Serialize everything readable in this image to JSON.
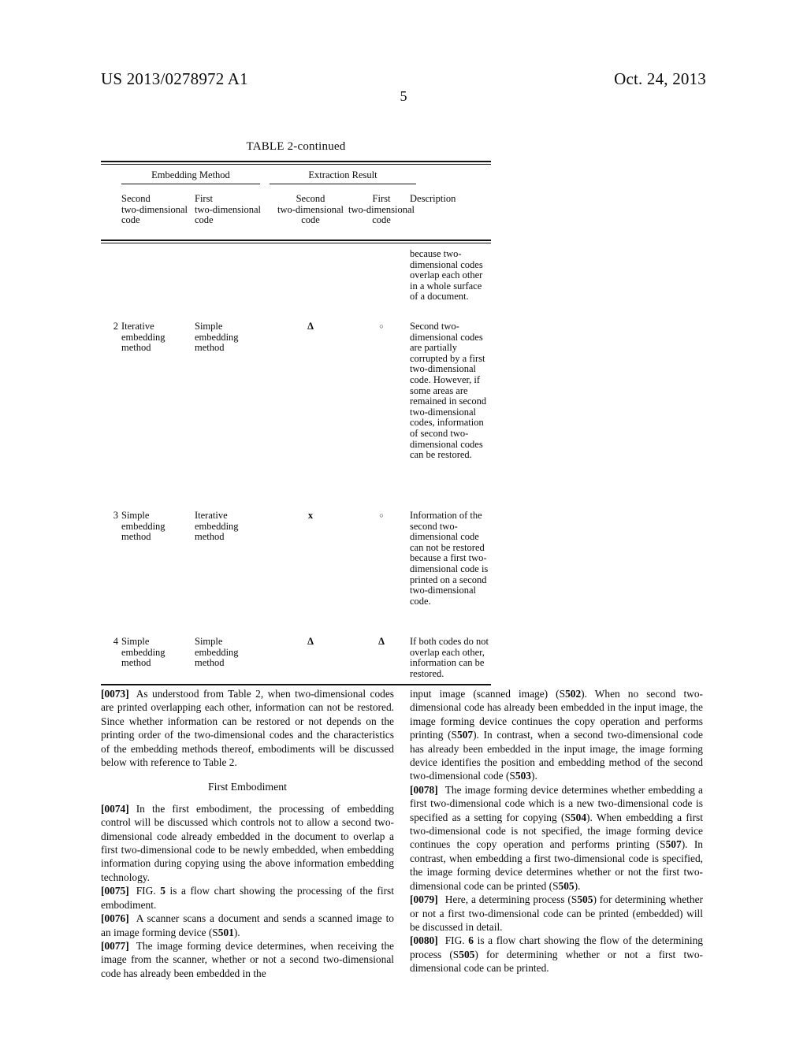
{
  "header": {
    "publication_number": "US 2013/0278972 A1",
    "publication_date": "Oct. 24, 2013",
    "page_number": "5"
  },
  "table": {
    "caption": "TABLE 2-continued",
    "group_headers": [
      {
        "label": "Embedding Method"
      },
      {
        "label": "Extraction Result"
      }
    ],
    "column_headers": [
      {
        "line1": "Second",
        "line2": "two-dimensional",
        "line3": "code"
      },
      {
        "line1": "First",
        "line2": "two-dimensional",
        "line3": "code"
      },
      {
        "line1": "Second",
        "line2": "two-dimensional",
        "line3": "code"
      },
      {
        "line1": "First",
        "line2": "two-dimensional",
        "line3": "code"
      },
      {
        "line1": "",
        "line2": "",
        "line3": "Description"
      }
    ],
    "continued_description": "because two-dimensional codes overlap each other in a whole surface of a document.",
    "rows": [
      {
        "num": "2",
        "embed_second": "Iterative embedding method",
        "embed_first": "Simple embedding method",
        "extract_second": "Δ",
        "extract_first": "○",
        "description": "Second two-dimensional codes are partially corrupted by a first two-dimensional code. However, if some areas are remained in second two-dimensional codes, information of second two-dimensional codes can be restored."
      },
      {
        "num": "3",
        "embed_second": "Simple embedding method",
        "embed_first": "Iterative embedding method",
        "extract_second": "x",
        "extract_first": "○",
        "description": "Information of the second two-dimensional code can not be restored because a first two-dimensional code is printed on a second two-dimensional code."
      },
      {
        "num": "4",
        "embed_second": "Simple embedding method",
        "embed_first": "Simple embedding method",
        "extract_second": "Δ",
        "extract_first": "Δ",
        "description": "If both codes do not overlap each other, information can be restored."
      }
    ]
  },
  "body": {
    "left_column": {
      "paragraphs": [
        {
          "id": "[0073]",
          "text": "As understood from Table 2, when two-dimensional codes are printed overlapping each other, information can not be restored. Since whether information can be restored or not depends on the printing order of the two-dimensional codes and the characteristics of the embedding methods thereof, embodiments will be discussed below with reference to Table 2."
        }
      ],
      "section_heading": "First Embodiment",
      "paragraphs_after_heading": [
        {
          "id": "[0074]",
          "text": "In the first embodiment, the processing of embedding control will be discussed which controls not to allow a second two-dimensional code already embedded in the document to overlap a first two-dimensional code to be newly embedded, when embedding information during copying using the above information embedding technology."
        },
        {
          "id": "[0075]",
          "text_part1": "FIG. ",
          "bold1": "5",
          "text_part2": " is a flow chart showing the processing of the first embodiment."
        },
        {
          "id": "[0076]",
          "text_part1": "A scanner scans a document and sends a scanned image to an image forming device (S",
          "bold1": "501",
          "text_part2": ")."
        },
        {
          "id": "[0077]",
          "text": "The image forming device determines, when receiving the image from the scanner, whether or not a second two-dimensional code has already been embedded in the"
        }
      ]
    },
    "right_column": {
      "continuation": {
        "text_part1": "input image (scanned image) (S",
        "bold1": "502",
        "text_part2": "). When no second two-dimensional code has already been embedded in the input image, the image forming device continues the copy operation and performs printing (S",
        "bold2": "507",
        "text_part3": "). In contrast, when a second two-dimensional code has already been embedded in the input image, the image forming device identifies the position and embedding method of the second two-dimensional code (S",
        "bold3": "503",
        "text_part4": ")."
      },
      "paragraphs": [
        {
          "id": "[0078]",
          "text_part1": "The image forming device determines whether embedding a first two-dimensional code which is a new two-dimensional code is specified as a setting for copying (S",
          "bold1": "504",
          "text_part2": "). When embedding a first two-dimensional code is not specified, the image forming device continues the copy operation and performs printing (S",
          "bold2": "507",
          "text_part3": "). In contrast, when embedding a first two-dimensional code is specified, the image forming device determines whether or not the first two-dimensional code can be printed (S",
          "bold3": "505",
          "text_part4": ")."
        },
        {
          "id": "[0079]",
          "text_part1": "Here, a determining process (S",
          "bold1": "505",
          "text_part2": ") for determining whether or not a first two-dimensional code can be printed (embedded) will be discussed in detail."
        },
        {
          "id": "[0080]",
          "text_part1": "FIG. ",
          "bold1": "6",
          "text_part2": " is a flow chart showing the flow of the determining process (S",
          "bold2": "505",
          "text_part3": ") for determining whether or not a first two-dimensional code can be printed."
        }
      ]
    }
  }
}
